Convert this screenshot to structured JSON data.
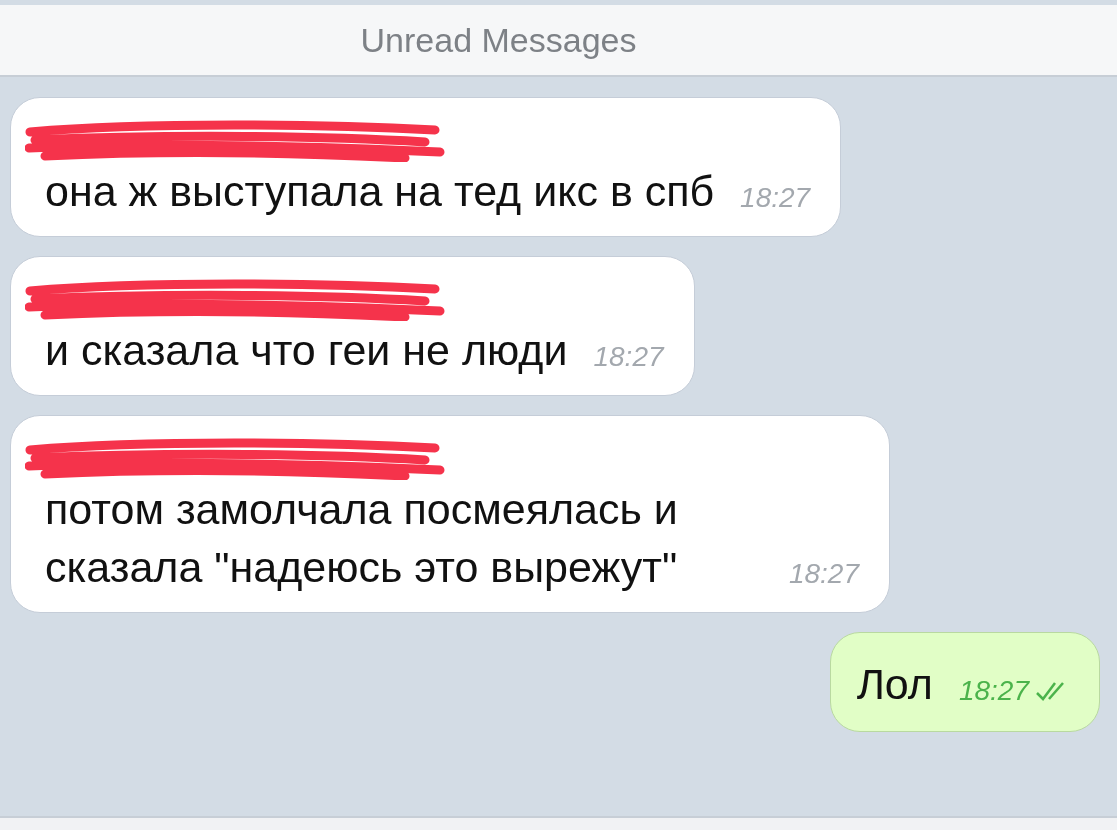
{
  "header": {
    "title": "Unread Messages"
  },
  "messages": [
    {
      "kind": "incoming",
      "sender_redacted": true,
      "text": "она ж выступала на тед икс в спб",
      "time": "18:27"
    },
    {
      "kind": "incoming",
      "sender_redacted": true,
      "text": "и сказала что геи не люди",
      "time": "18:27"
    },
    {
      "kind": "incoming",
      "sender_redacted": true,
      "text": "потом замолчала посмеялась и сказала \"надеюсь это вырежут\"",
      "time": "18:27"
    },
    {
      "kind": "outgoing",
      "text": "Лол",
      "time": "18:27",
      "read": true
    }
  ]
}
